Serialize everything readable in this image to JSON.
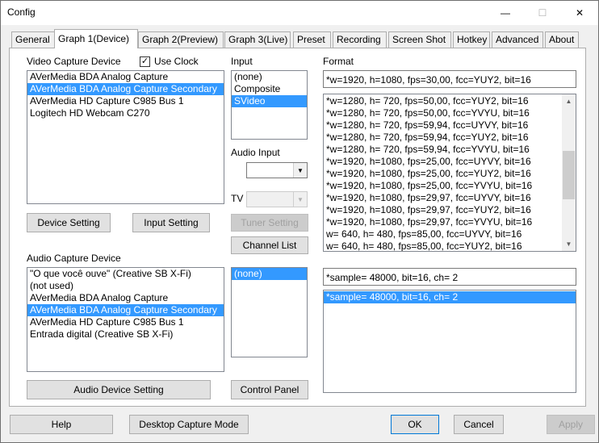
{
  "window": {
    "title": "Config",
    "minimize": "—",
    "maximize": "☐",
    "close": "✕"
  },
  "tabs": [
    {
      "label": "General"
    },
    {
      "label": "Graph 1(Device)"
    },
    {
      "label": "Graph 2(Preview)"
    },
    {
      "label": "Graph 3(Live)"
    },
    {
      "label": "Preset"
    },
    {
      "label": "Recording"
    },
    {
      "label": "Screen Shot"
    },
    {
      "label": "Hotkey"
    },
    {
      "label": "Advanced"
    },
    {
      "label": "About"
    }
  ],
  "video": {
    "label": "Video Capture Device",
    "use_clock_label": "Use Clock",
    "use_clock_checked": "✓",
    "devices": [
      "AVerMedia BDA Analog Capture",
      "AVerMedia BDA Analog Capture Secondary",
      "AVerMedia HD Capture C985 Bus 1",
      "Logitech HD Webcam C270"
    ],
    "device_setting": "Device Setting",
    "input_setting": "Input Setting"
  },
  "input": {
    "label": "Input",
    "items": [
      "(none)",
      "Composite",
      "SVideo"
    ],
    "audio_input_label": "Audio Input",
    "audio_input_value": "",
    "tv_label": "TV",
    "tv_value": "",
    "tuner_setting": "Tuner Setting",
    "channel_list": "Channel List"
  },
  "format": {
    "label": "Format",
    "current": "*w=1920, h=1080, fps=30,00,  fcc=YUY2, bit=16",
    "items": [
      "*w=1280, h= 720, fps=50,00,  fcc=YUY2, bit=16",
      "*w=1280, h= 720, fps=50,00,  fcc=YVYU, bit=16",
      "*w=1280, h= 720, fps=59,94,  fcc=UYVY, bit=16",
      "*w=1280, h= 720, fps=59,94,  fcc=YUY2, bit=16",
      "*w=1280, h= 720, fps=59,94,  fcc=YVYU, bit=16",
      "*w=1920, h=1080, fps=25,00,  fcc=UYVY, bit=16",
      "*w=1920, h=1080, fps=25,00,  fcc=YUY2, bit=16",
      "*w=1920, h=1080, fps=25,00,  fcc=YVYU, bit=16",
      "*w=1920, h=1080, fps=29,97,  fcc=UYVY, bit=16",
      "*w=1920, h=1080, fps=29,97,  fcc=YUY2, bit=16",
      "*w=1920, h=1080, fps=29,97,  fcc=YVYU, bit=16",
      "w= 640, h= 480, fps=85,00,  fcc=UYVY, bit=16",
      "w= 640, h= 480, fps=85,00,  fcc=YUY2, bit=16"
    ]
  },
  "audio": {
    "label": "Audio Capture Device",
    "devices": [
      "\"O que você ouve\" (Creative SB X-Fi)",
      "(not used)",
      "AVerMedia BDA Analog Capture",
      "AVerMedia BDA Analog Capture Secondary",
      "AVerMedia HD Capture C985 Bus 1",
      "Entrada digital (Creative SB X-Fi)"
    ],
    "inputs": [
      "(none)"
    ],
    "device_setting": "Audio Device Setting",
    "control_panel": "Control Panel",
    "format_current": "*sample= 48000, bit=16, ch= 2",
    "formats": [
      "*sample= 48000, bit=16, ch= 2"
    ]
  },
  "footer": {
    "help": "Help",
    "desktop_capture_mode": "Desktop Capture Mode",
    "ok": "OK",
    "cancel": "Cancel",
    "apply": "Apply"
  }
}
